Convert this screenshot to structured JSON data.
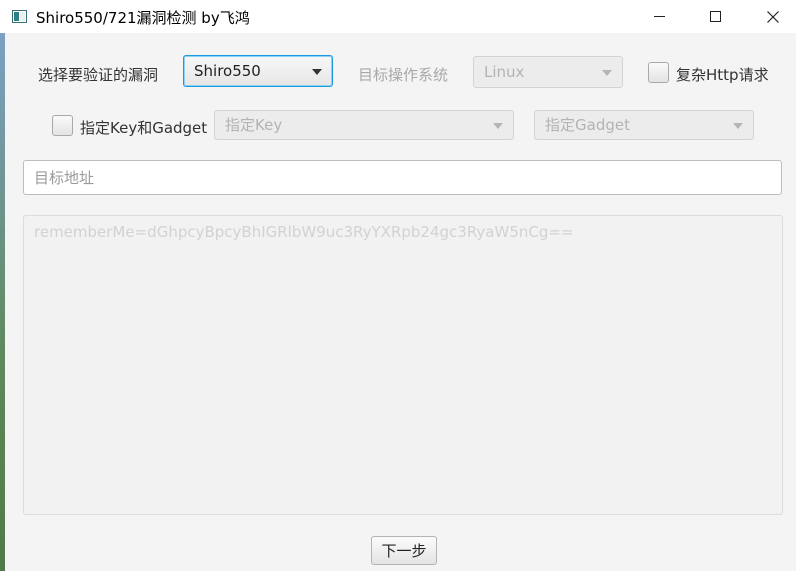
{
  "window": {
    "title": "Shiro550/721漏洞检测  by飞鸿"
  },
  "form": {
    "vuln_label": "选择要验证的漏洞",
    "vuln_selected": "Shiro550",
    "os_label": "目标操作系统",
    "os_selected": "Linux",
    "complex_http_label": "复杂Http请求",
    "specify_key_gadget_label": "指定Key和Gadget",
    "key_placeholder": "指定Key",
    "gadget_placeholder": "指定Gadget",
    "target_placeholder": "目标地址",
    "cookie_placeholder": "rememberMe=dGhpcyBpcyBhIGRlbW9uc3RyYXRpb24gc3RyaW5nCg==",
    "next_button": "下一步"
  },
  "colors": {
    "focus_border": "#1b9ae0",
    "background": "#f4f4f4",
    "disabled_text": "#a8a8a8"
  }
}
